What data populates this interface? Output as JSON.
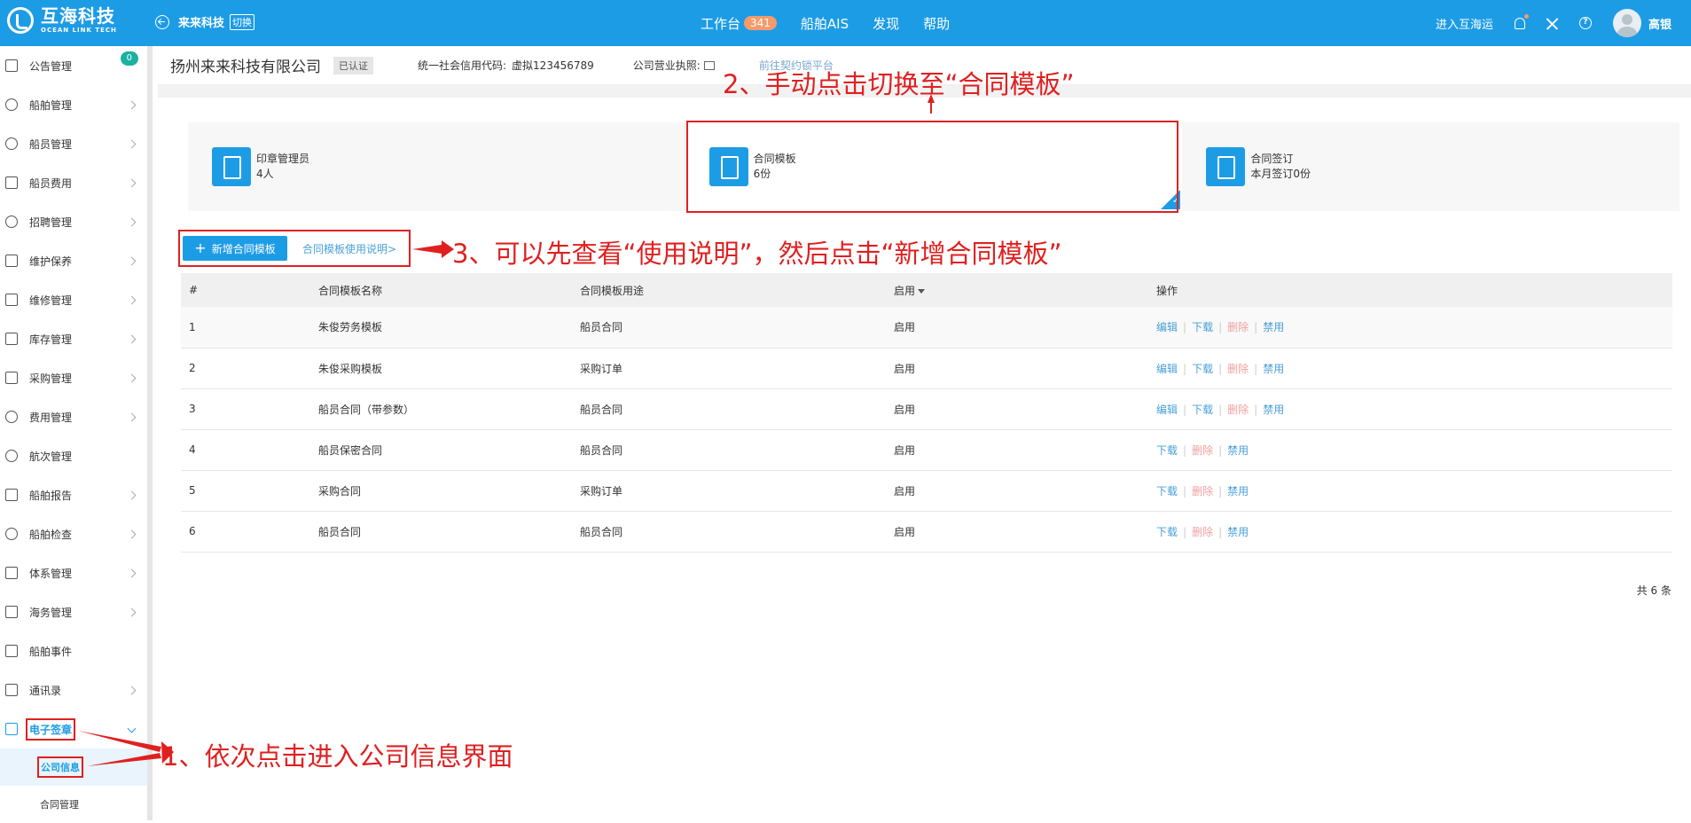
{
  "topbar": {
    "logo_cn": "互海科技",
    "logo_en": "OCEAN LINK TECH",
    "company": "来来科技",
    "switch_label": "切换",
    "nav": [
      {
        "label": "工作台",
        "badge": "341"
      },
      {
        "label": "船舶AIS"
      },
      {
        "label": "发现"
      },
      {
        "label": "帮助"
      }
    ],
    "enter_label": "进入互海运",
    "username": "高银"
  },
  "sidebar": {
    "items": [
      {
        "label": "公告管理",
        "badge": "0"
      },
      {
        "label": "船舶管理"
      },
      {
        "label": "船员管理"
      },
      {
        "label": "船员费用"
      },
      {
        "label": "招聘管理"
      },
      {
        "label": "维护保养"
      },
      {
        "label": "维修管理"
      },
      {
        "label": "库存管理"
      },
      {
        "label": "采购管理"
      },
      {
        "label": "费用管理"
      },
      {
        "label": "航次管理"
      },
      {
        "label": "船舶报告"
      },
      {
        "label": "船舶检查"
      },
      {
        "label": "体系管理"
      },
      {
        "label": "海务管理"
      },
      {
        "label": "船舶事件"
      },
      {
        "label": "通讯录"
      },
      {
        "label": "电子签章"
      }
    ],
    "sub": [
      {
        "label": "公司信息"
      },
      {
        "label": "合同管理"
      }
    ]
  },
  "infobar": {
    "company_name": "扬州来来科技有限公司",
    "verified": "已认证",
    "credit_label": "统一社会信用代码:",
    "credit_value": "虚拟123456789",
    "license_label": "公司营业执照:",
    "sign_link": "前往契约锁平台"
  },
  "cards": [
    {
      "title": "印章管理员",
      "value": "4人"
    },
    {
      "title": "合同模板",
      "value": "6份"
    },
    {
      "title": "合同签订",
      "value": "本月签订0份"
    }
  ],
  "toolbar": {
    "add_label": "新增合同模板",
    "help_link": "合同模板使用说明>"
  },
  "table": {
    "headers": [
      "#",
      "合同模板名称",
      "合同模板用途",
      "启用",
      "操作"
    ],
    "rows": [
      {
        "no": "1",
        "name": "朱俊劳务模板",
        "use": "船员合同",
        "status": "启用",
        "ops": [
          "编辑",
          "下载",
          "删除",
          "禁用"
        ]
      },
      {
        "no": "2",
        "name": "朱俊采购模板",
        "use": "采购订单",
        "status": "启用",
        "ops": [
          "编辑",
          "下载",
          "删除",
          "禁用"
        ]
      },
      {
        "no": "3",
        "name": "船员合同（带参数）",
        "use": "船员合同",
        "status": "启用",
        "ops": [
          "编辑",
          "下载",
          "删除",
          "禁用"
        ]
      },
      {
        "no": "4",
        "name": "船员保密合同",
        "use": "船员合同",
        "status": "启用",
        "ops": [
          "下载",
          "删除",
          "禁用"
        ]
      },
      {
        "no": "5",
        "name": "采购合同",
        "use": "采购订单",
        "status": "启用",
        "ops": [
          "下载",
          "删除",
          "禁用"
        ]
      },
      {
        "no": "6",
        "name": "船员合同",
        "use": "船员合同",
        "status": "启用",
        "ops": [
          "下载",
          "删除",
          "禁用"
        ]
      }
    ],
    "total": "共 6 条"
  },
  "annotations": {
    "step1": "1、依次点击进入公司信息界面",
    "step2": "2、手动点击切换至“合同模板”",
    "step3": "3、可以先查看“使用说明”，然后点击“新增合同模板”"
  },
  "colors": {
    "primary": "#1d9ce6",
    "annotation": "#e02020",
    "badge": "#f59b6a"
  }
}
